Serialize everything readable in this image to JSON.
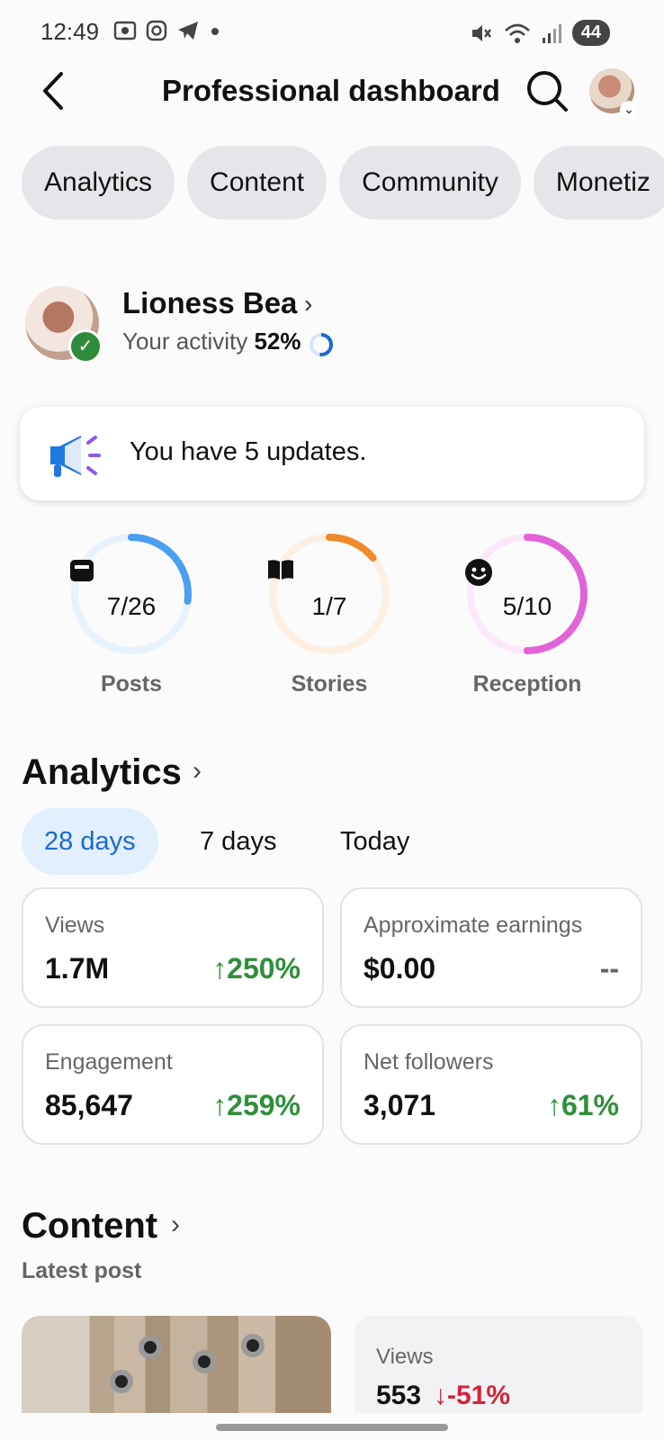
{
  "status_bar": {
    "time": "12:49",
    "battery": "44"
  },
  "header": {
    "title": "Professional dashboard"
  },
  "tabs": [
    {
      "label": "Analytics"
    },
    {
      "label": "Content"
    },
    {
      "label": "Community"
    },
    {
      "label": "Monetiz"
    }
  ],
  "profile": {
    "name": "Lioness Bea",
    "activity_label": "Your activity",
    "activity_value": "52%",
    "activity_fraction": 0.52
  },
  "updates": {
    "text": "You have 5 updates."
  },
  "progress_rings": [
    {
      "label": "Posts",
      "value": "7/26",
      "fraction": 0.27,
      "color": "#4a9ff0",
      "track": "#e7f2fd",
      "icon": "posts-icon"
    },
    {
      "label": "Stories",
      "value": "1/7",
      "fraction": 0.14,
      "color": "#ef8a2a",
      "track": "#fdf0e3",
      "icon": "book-icon"
    },
    {
      "label": "Reception",
      "value": "5/10",
      "fraction": 0.5,
      "color": "#e262d8",
      "track": "#fbe8fa",
      "icon": "smiley-icon"
    }
  ],
  "analytics": {
    "title": "Analytics",
    "periods": [
      {
        "label": "28 days",
        "active": true
      },
      {
        "label": "7 days",
        "active": false
      },
      {
        "label": "Today",
        "active": false
      }
    ],
    "stats": [
      {
        "label": "Views",
        "value": "1.7M",
        "change": "250%",
        "trend": "up"
      },
      {
        "label": "Approximate earnings",
        "value": "$0.00",
        "change": "--",
        "trend": "none"
      },
      {
        "label": "Engagement",
        "value": "85,647",
        "change": "259%",
        "trend": "up"
      },
      {
        "label": "Net followers",
        "value": "3,071",
        "change": "61%",
        "trend": "up"
      }
    ]
  },
  "content": {
    "title": "Content",
    "subtitle": "Latest post",
    "latest": {
      "views_label": "Views",
      "views_value": "553",
      "views_change": "-51%",
      "trend": "down"
    }
  },
  "colors": {
    "accent": "#1a6ad3",
    "positive": "#2f8f3a",
    "negative": "#d3233a",
    "verified": "#2e8b3c"
  }
}
